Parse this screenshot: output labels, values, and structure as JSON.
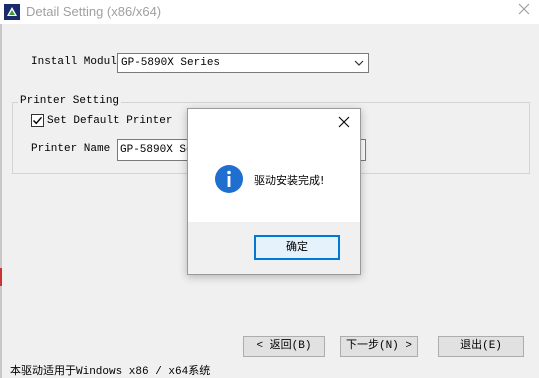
{
  "window": {
    "title": "Detail Setting (x86/x64)",
    "icon": "printer-app-icon",
    "close_icon": "close-icon"
  },
  "install_module": {
    "label": "Install Module",
    "selected": "GP-5890X Series"
  },
  "printer_setting": {
    "group_label": "Printer Setting",
    "set_default_label": "Set Default Printer",
    "set_default_checked": true,
    "printer_name_label": "Printer Name",
    "printer_name_value": "GP-5890X Series"
  },
  "buttons": {
    "back": "< 返回(B)",
    "next": "下一步(N) >",
    "exit": "退出(E)"
  },
  "status_text": "本驱动适用于Windows x86 / x64系统",
  "dialog": {
    "message": "驱动安装完成!",
    "ok_label": "确定",
    "icon": "info-icon"
  },
  "colors": {
    "accent": "#0078d7",
    "info_icon": "#1e6fd0"
  }
}
